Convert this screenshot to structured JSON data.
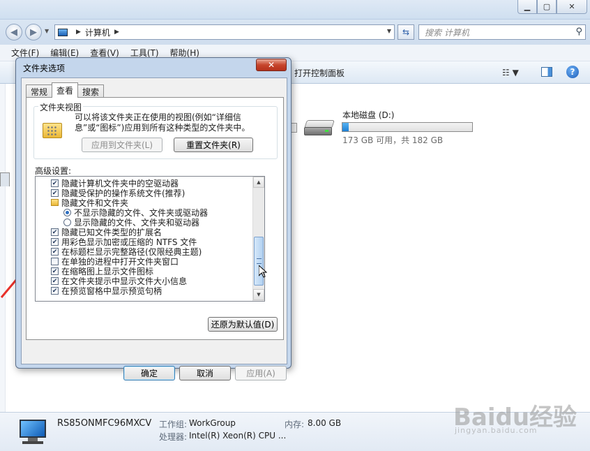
{
  "explorer": {
    "address_path": "计算机",
    "search_placeholder": "搜索 计算机",
    "menu": [
      "文件(F)",
      "编辑(E)",
      "查看(V)",
      "工具(T)",
      "帮助(H)"
    ],
    "cmd_control_panel": "打开控制面板",
    "drive": {
      "name": "本地磁盘 (D:)",
      "free_text": "173 GB 可用，共 182 GB",
      "used_fraction": 0.05
    },
    "details": {
      "pc_name": "RS85ONMFC96MXCV",
      "workgroup_label": "工作组:",
      "workgroup_value": "WorkGroup",
      "memory_label": "内存:",
      "memory_value": "8.00 GB",
      "cpu_label": "处理器:",
      "cpu_value": "Intel(R) Xeon(R) CPU ..."
    },
    "watermark": "Baidu经验",
    "watermark_sub": "jingyan.baidu.com"
  },
  "dialog": {
    "title": "文件夹选项",
    "tabs": [
      "常规",
      "查看",
      "搜索"
    ],
    "active_tab": "查看",
    "folder_views": {
      "label": "文件夹视图",
      "description": "可以将该文件夹正在使用的视图(例如“详细信息”或“图标”)应用到所有这种类型的文件夹中。",
      "apply_button": "应用到文件夹(L)",
      "reset_button": "重置文件夹(R)"
    },
    "advanced_label": "高级设置:",
    "advanced_items": [
      {
        "kind": "checkbox",
        "checked": true,
        "indent": 0,
        "label": "隐藏计算机文件夹中的空驱动器"
      },
      {
        "kind": "checkbox",
        "checked": true,
        "indent": 0,
        "label": "隐藏受保护的操作系统文件(推荐)"
      },
      {
        "kind": "folder",
        "checked": false,
        "indent": 0,
        "label": "隐藏文件和文件夹"
      },
      {
        "kind": "radio",
        "checked": true,
        "indent": 1,
        "label": "不显示隐藏的文件、文件夹或驱动器"
      },
      {
        "kind": "radio",
        "checked": false,
        "indent": 1,
        "label": "显示隐藏的文件、文件夹和驱动器"
      },
      {
        "kind": "checkbox",
        "checked": true,
        "indent": 0,
        "label": "隐藏已知文件类型的扩展名"
      },
      {
        "kind": "checkbox",
        "checked": true,
        "indent": 0,
        "label": "用彩色显示加密或压缩的 NTFS 文件"
      },
      {
        "kind": "checkbox",
        "checked": true,
        "indent": 0,
        "label": "在标题栏显示完整路径(仅限经典主题)"
      },
      {
        "kind": "checkbox",
        "checked": false,
        "indent": 0,
        "label": "在单独的进程中打开文件夹窗口"
      },
      {
        "kind": "checkbox",
        "checked": true,
        "indent": 0,
        "label": "在缩略图上显示文件图标"
      },
      {
        "kind": "checkbox",
        "checked": true,
        "indent": 0,
        "label": "在文件夹提示中显示文件大小信息"
      },
      {
        "kind": "checkbox",
        "checked": true,
        "indent": 0,
        "label": "在预览窗格中显示预览句柄"
      }
    ],
    "restore_button": "还原为默认值(D)",
    "ok_button": "确定",
    "cancel_button": "取消",
    "apply_button": "应用(A)"
  }
}
